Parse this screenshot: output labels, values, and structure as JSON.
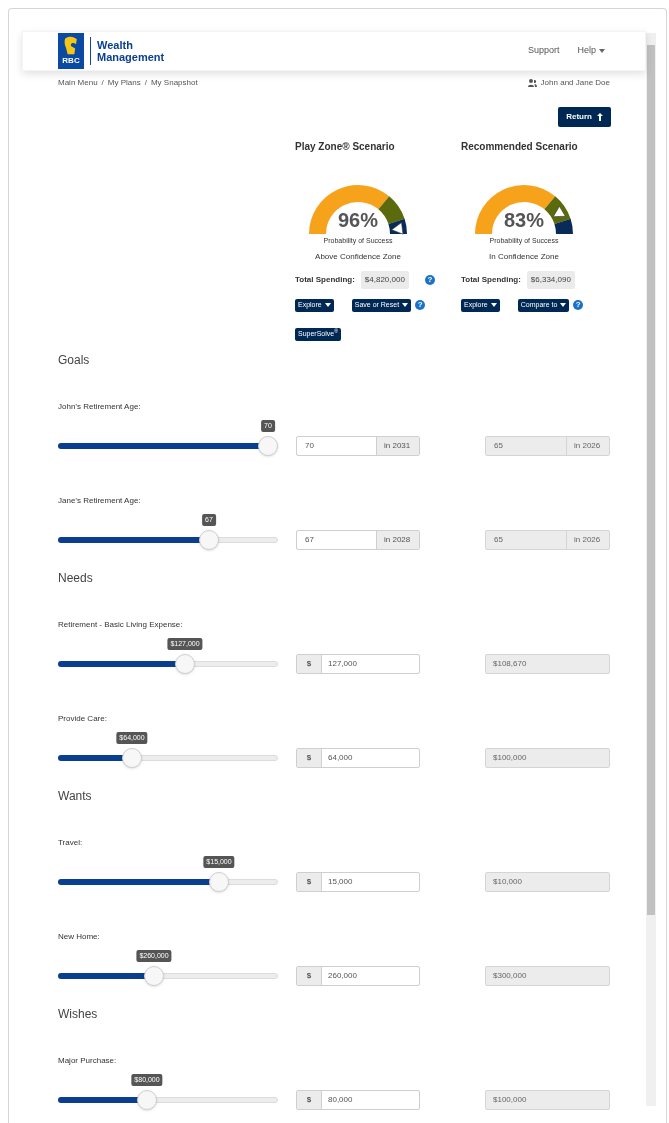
{
  "header": {
    "logo": "RBC",
    "brand": "Wealth Management",
    "nav": [
      {
        "label": "Support",
        "dropdown": false
      },
      {
        "label": "Help",
        "dropdown": true
      }
    ]
  },
  "breadcrumb": {
    "items": [
      "Main Menu",
      "My Plans",
      "My Snapshot"
    ],
    "separator": "/"
  },
  "user": "John and Jane Doe",
  "return_button": "Return",
  "scenarios": [
    {
      "title": "Play Zone® Scenario",
      "percent": "96%",
      "caption": "Probability of Success",
      "zone": "Above Confidence Zone",
      "spending_label": "Total Spending:",
      "spending": "$4,820,000",
      "spending_help": "?",
      "buttons": [
        {
          "label": "Explore",
          "dropdown": true
        },
        {
          "label": "Save or Reset",
          "dropdown": true
        }
      ],
      "buttons_help": "?",
      "extra_button": "SuperSolve$^{®}$"
    },
    {
      "title": "Recommended Scenario",
      "percent": "83%",
      "caption": "Probability of Success",
      "zone": "In Confidence Zone",
      "spending_label": "Total Spending:",
      "spending": "$6,334,090",
      "buttons": [
        {
          "label": "Explore",
          "dropdown": true
        },
        {
          "label": "Compare to",
          "dropdown": true
        }
      ],
      "buttons_help": "?"
    }
  ],
  "sections": [
    {
      "title": "Goals",
      "rows": [
        {
          "kind": "age",
          "label": "John’s Retirement Age:",
          "level": 1.0,
          "tooltip": "70",
          "value": "70",
          "suffix": "in 2031",
          "recommended": "65",
          "recommended_suffix": "in 2026"
        },
        {
          "kind": "age",
          "label": "Jane’s Retirement Age:",
          "level": 0.705,
          "tooltip": "67",
          "value": "67",
          "suffix": "in 2028",
          "recommended": "65",
          "recommended_suffix": "in 2026"
        }
      ]
    },
    {
      "title": "Needs",
      "rows": [
        {
          "kind": "money",
          "label": "Retirement - Basic Living Expense:",
          "level": 0.585,
          "tooltip": "$127,000",
          "prefix": "$",
          "value": "127,000",
          "recommended": "$108,670"
        },
        {
          "kind": "money",
          "label": "Provide Care:",
          "level": 0.32,
          "tooltip": "$64,000",
          "prefix": "$",
          "value": "64,000",
          "recommended": "$100,000"
        }
      ]
    },
    {
      "title": "Wants",
      "rows": [
        {
          "kind": "money",
          "label": "Travel:",
          "level": 0.755,
          "tooltip": "$15,000",
          "prefix": "$",
          "value": "15,000",
          "recommended": "$10,000"
        },
        {
          "kind": "money",
          "label": "New Home:",
          "level": 0.43,
          "tooltip": "$260,000",
          "prefix": "$",
          "value": "260,000",
          "recommended": "$300,000"
        }
      ]
    },
    {
      "title": "Wishes",
      "rows": [
        {
          "kind": "money",
          "label": "Major Purchase:",
          "level": 0.395,
          "tooltip": "$80,000",
          "prefix": "$",
          "value": "80,000",
          "recommended": "$100,000"
        }
      ]
    }
  ]
}
